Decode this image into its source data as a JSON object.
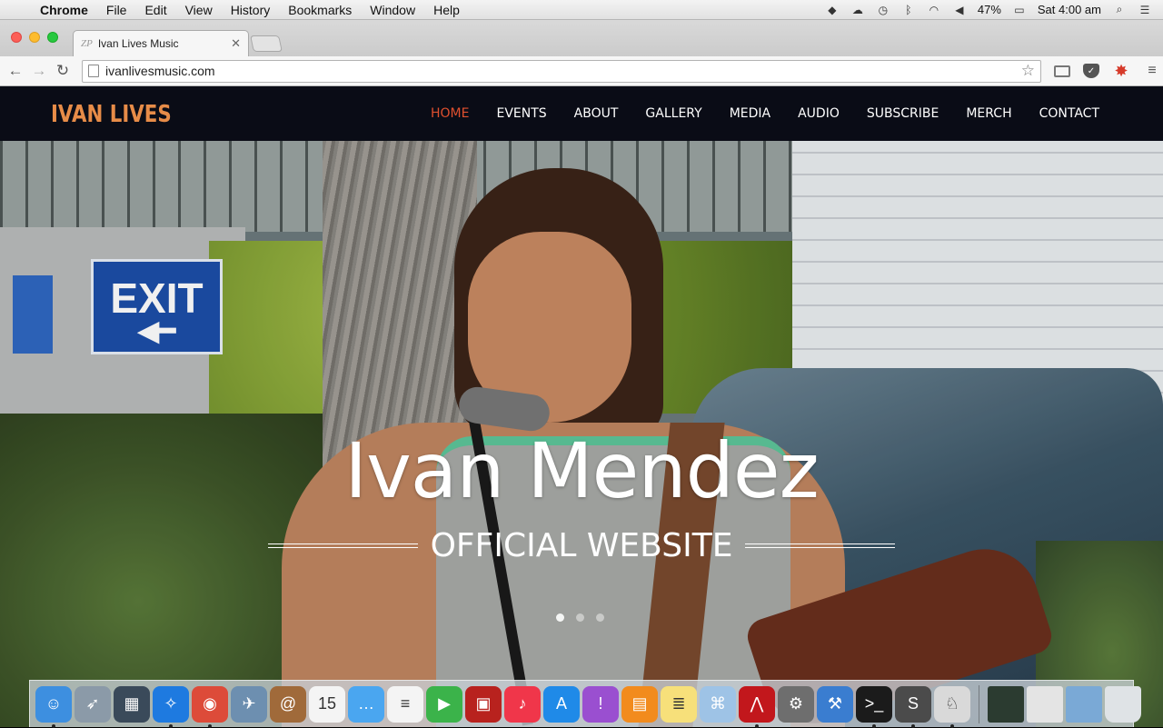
{
  "menubar": {
    "app_name": "Chrome",
    "items": [
      "File",
      "Edit",
      "View",
      "History",
      "Bookmarks",
      "Window",
      "Help"
    ],
    "battery": "47%",
    "clock": "Sat 4:00 am"
  },
  "browser": {
    "tab_title": "Ivan Lives Music",
    "tab_favicon_text": "ZP",
    "url": "ivanlivesmusic.com"
  },
  "site": {
    "logo": "IVAN LIVES",
    "nav": [
      {
        "label": "HOME",
        "active": true
      },
      {
        "label": "EVENTS"
      },
      {
        "label": "ABOUT"
      },
      {
        "label": "GALLERY"
      },
      {
        "label": "MEDIA"
      },
      {
        "label": "AUDIO"
      },
      {
        "label": "SUBSCRIBE"
      },
      {
        "label": "MERCH"
      },
      {
        "label": "CONTACT"
      }
    ],
    "hero_title": "Ivan Mendez",
    "hero_subtitle": "OFFICIAL WEBSITE",
    "exit_sign": "EXIT",
    "slides_count": 3,
    "active_slide": 1
  },
  "dock": {
    "apps": [
      {
        "name": "finder",
        "color": "#3d8fe0",
        "glyph": "☺",
        "running": true
      },
      {
        "name": "launchpad",
        "color": "#8b9aa8",
        "glyph": "➶",
        "running": false
      },
      {
        "name": "mission-control",
        "color": "#3a4a5a",
        "glyph": "▦",
        "running": false
      },
      {
        "name": "safari",
        "color": "#1e7ae0",
        "glyph": "✧",
        "running": true
      },
      {
        "name": "chrome",
        "color": "#dd4b39",
        "glyph": "◉",
        "running": true
      },
      {
        "name": "preview",
        "color": "#6d8fb0",
        "glyph": "✈",
        "running": false
      },
      {
        "name": "contacts",
        "color": "#a06a3a",
        "glyph": "@",
        "running": false
      },
      {
        "name": "calendar",
        "color": "#f4f4f4",
        "glyph": "15",
        "running": false
      },
      {
        "name": "messages",
        "color": "#4aa6f0",
        "glyph": "…",
        "running": false
      },
      {
        "name": "reminders",
        "color": "#f4f4f4",
        "glyph": "≡",
        "running": false
      },
      {
        "name": "facetime",
        "color": "#3bb34a",
        "glyph": "▶",
        "running": false
      },
      {
        "name": "photo-booth",
        "color": "#b8221e",
        "glyph": "▣",
        "running": false
      },
      {
        "name": "itunes",
        "color": "#f0364a",
        "glyph": "♪",
        "running": false
      },
      {
        "name": "app-store",
        "color": "#1f8ae8",
        "glyph": "A",
        "running": false
      },
      {
        "name": "feedback",
        "color": "#9a4fd0",
        "glyph": "!",
        "running": false
      },
      {
        "name": "ibooks",
        "color": "#f28b1d",
        "glyph": "▤",
        "running": false
      },
      {
        "name": "notes",
        "color": "#f7e07a",
        "glyph": "≣",
        "running": false
      },
      {
        "name": "preview-photos",
        "color": "#9ec3e6",
        "glyph": "⌘",
        "running": false
      },
      {
        "name": "acrobat",
        "color": "#c2171c",
        "glyph": "⋀",
        "running": true
      },
      {
        "name": "system-preferences",
        "color": "#6e6e6e",
        "glyph": "⚙",
        "running": false
      },
      {
        "name": "xcode",
        "color": "#3a7dd0",
        "glyph": "⚒",
        "running": false
      },
      {
        "name": "terminal",
        "color": "#1b1b1b",
        "glyph": ">_",
        "running": true
      },
      {
        "name": "sublime-text",
        "color": "#4b4b4b",
        "glyph": "S",
        "running": true
      },
      {
        "name": "mamp",
        "color": "#d9d9d9",
        "glyph": "♘",
        "running": true
      }
    ],
    "others": [
      {
        "name": "activity-monitor-window",
        "color": "#2b3b30"
      },
      {
        "name": "mamp-window",
        "color": "#e4e4e4"
      },
      {
        "name": "finder-window",
        "color": "#7aa9d6"
      },
      {
        "name": "trash",
        "color": "#dfe3e6"
      }
    ]
  }
}
